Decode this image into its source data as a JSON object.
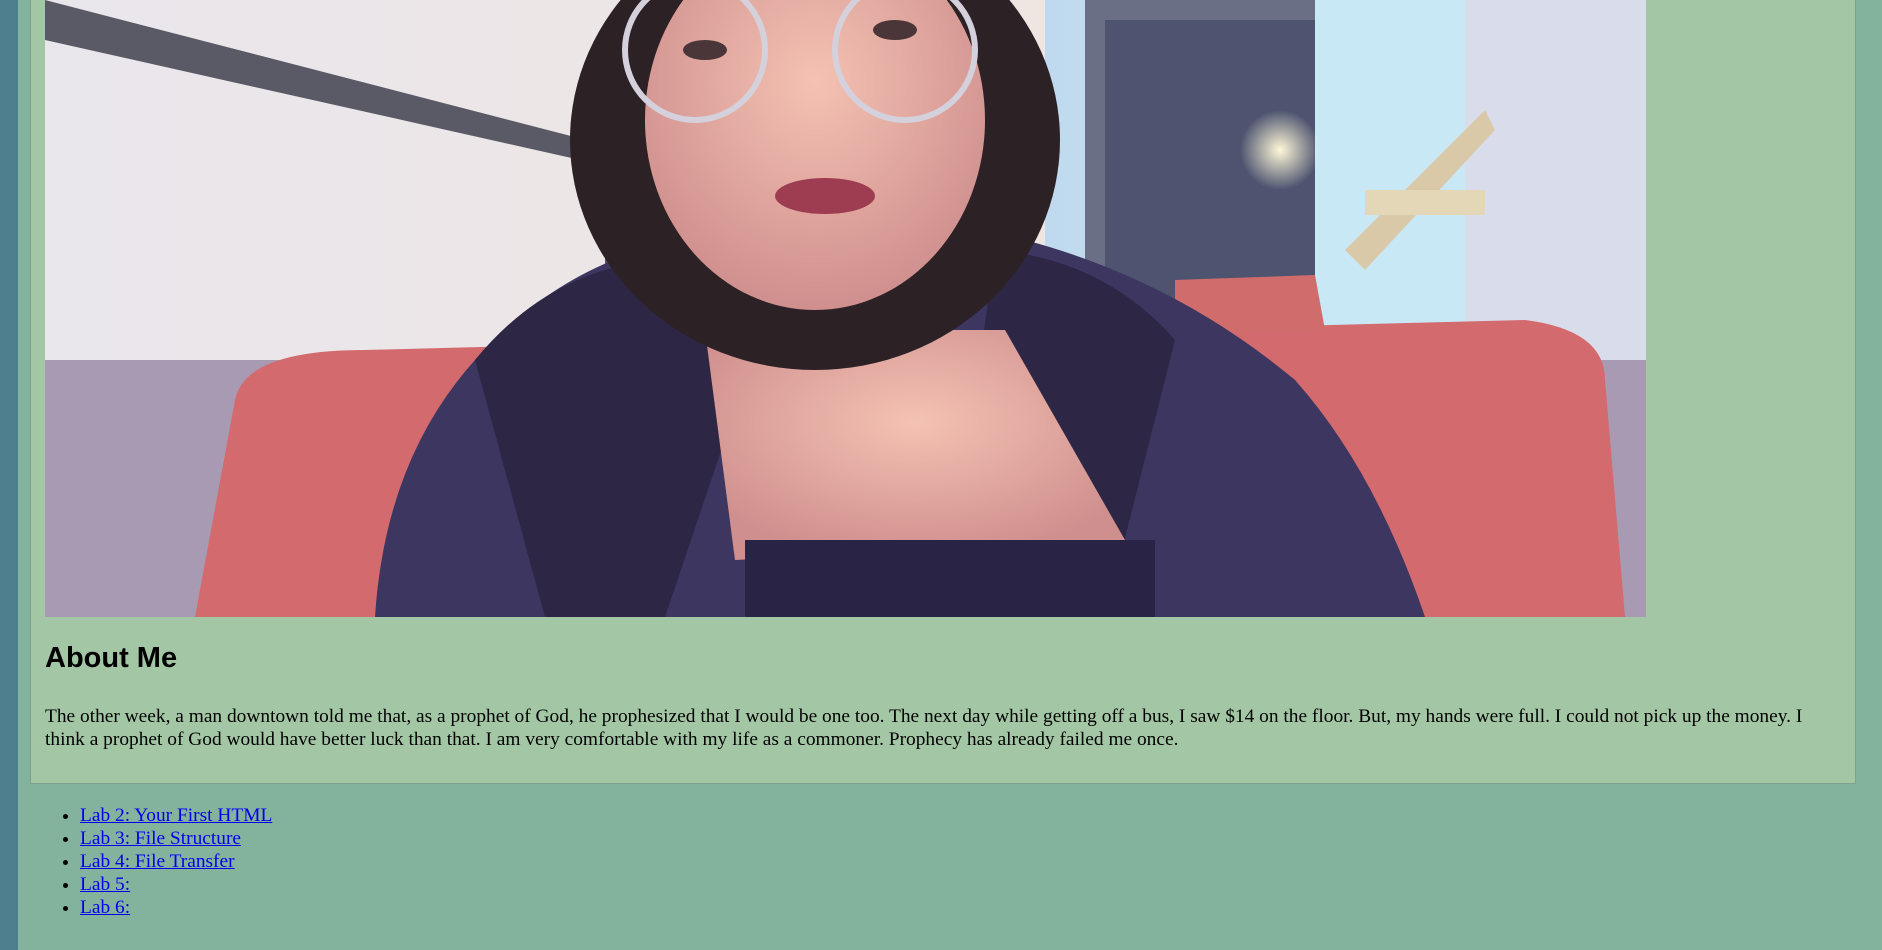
{
  "photo": {
    "description_icon": "portrait-photo"
  },
  "about": {
    "heading": "About Me",
    "text": "The other week, a man downtown told me that, as a prophet of God, he prophesized that I would be one too. The next day while getting off a bus, I saw $14 on the floor. But, my hands were full. I could not pick up the money. I think a prophet of God would have better luck than that. I am very comfortable with my life as a commoner. Prophecy has already failed me once."
  },
  "labs": {
    "items": [
      {
        "label": "Lab 2: Your First HTML"
      },
      {
        "label": "Lab 3: File Structure"
      },
      {
        "label": "Lab 4: File Transfer"
      },
      {
        "label": "Lab 5:"
      },
      {
        "label": "Lab 6:"
      }
    ]
  },
  "colors": {
    "outer_bg": "#4e7f8f",
    "page_bg": "#83b39d",
    "card_bg": "#a3c7a5",
    "link": "#0000ee"
  }
}
